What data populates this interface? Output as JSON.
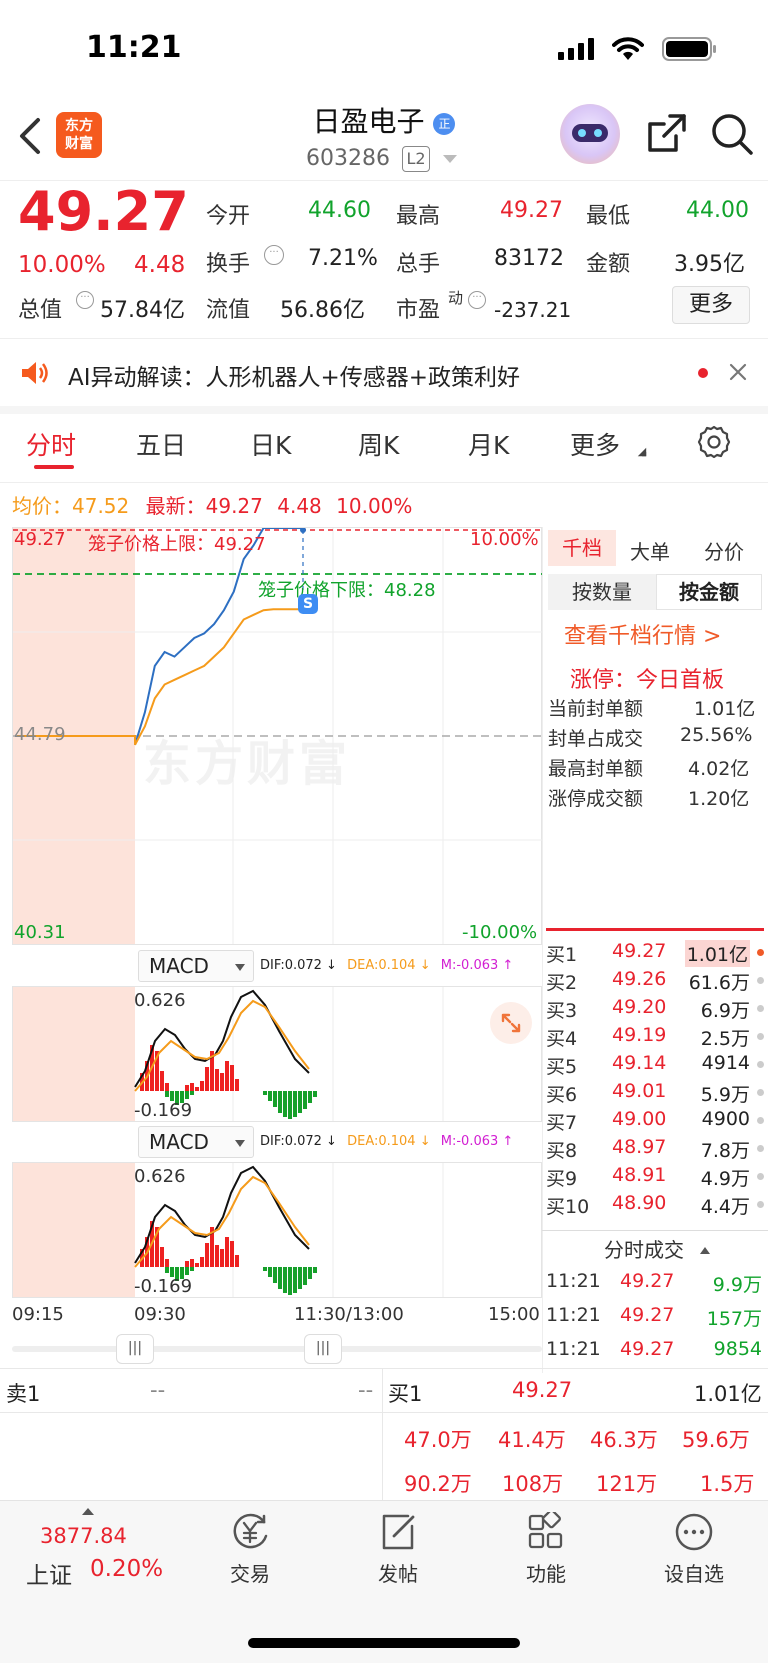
{
  "status_bar": {
    "time": "11:21"
  },
  "header": {
    "stock_name": "日盈电子",
    "code": "603286",
    "level_badge": "L2",
    "logo_text_1": "东方",
    "logo_text_2": "财富"
  },
  "quote": {
    "price": "49.27",
    "change_pct": "10.00%",
    "change": "4.48",
    "open_label": "今开",
    "open": "44.60",
    "high_label": "最高",
    "high": "49.27",
    "low_label": "最低",
    "low": "44.00",
    "turnover_label": "换手",
    "turnover": "7.21%",
    "volume_label": "总手",
    "volume": "83172",
    "amount_label": "金额",
    "amount": "3.95亿",
    "mktcap_label": "总值",
    "mktcap": "57.84亿",
    "float_label": "流值",
    "float": "56.86亿",
    "pe_label": "市盈",
    "pe_sup": "动",
    "pe": "-237.21",
    "more_button": "更多"
  },
  "ai_banner": {
    "text": "AI异动解读：人形机器人+传感器+政策利好"
  },
  "chart_tabs": [
    "分时",
    "五日",
    "日K",
    "周K",
    "月K",
    "更多"
  ],
  "chart_legend": {
    "avg_label": "均价：",
    "avg": "47.52",
    "latest_label": "最新：",
    "latest": "49.27",
    "latest_chg": "4.48",
    "latest_pct": "10.00%"
  },
  "chart_labels": {
    "top_price": "49.27",
    "top_pct": "10.00%",
    "upper_limit_label": "笼子价格上限：49.27",
    "lower_limit_label": "笼子价格下限：48.28",
    "mid_price": "44.79",
    "bottom_price": "40.31",
    "bottom_pct": "-10.00%",
    "watermark": "东方财富",
    "s_marker": "S"
  },
  "chart_data": {
    "type": "line",
    "title": "",
    "ylim": [
      40.31,
      49.27
    ],
    "prev_close": 44.79,
    "x_ticks": [
      "09:15",
      "09:30",
      "11:30/13:00",
      "15:00"
    ],
    "series": [
      {
        "name": "最新",
        "color": "#2d6fc2",
        "values": [
          44.79,
          44.79,
          44.79,
          44.79,
          44.79,
          44.79,
          44.79,
          44.6,
          45.3,
          46.3,
          46.6,
          46.5,
          46.7,
          46.9,
          47.0,
          47.2,
          47.5,
          47.9,
          48.6,
          48.9,
          49.27,
          49.27,
          49.27,
          49.27,
          49.27
        ]
      },
      {
        "name": "均价",
        "color": "#f59b1b",
        "values": [
          44.79,
          44.79,
          44.79,
          44.79,
          44.79,
          44.79,
          44.79,
          44.6,
          45.0,
          45.6,
          45.9,
          46.0,
          46.1,
          46.2,
          46.3,
          46.5,
          46.7,
          47.0,
          47.3,
          47.4,
          47.5,
          47.52,
          47.52,
          47.52,
          47.52
        ]
      }
    ]
  },
  "right_panel": {
    "tabs": [
      "千档",
      "单",
      "分价"
    ],
    "tab_big_order": "大单",
    "subtabs": [
      "按数量",
      "按金额"
    ],
    "link": "查看千档行情 >",
    "limit_up_title": "涨停：今日首板",
    "rows": [
      {
        "label": "当前封单额",
        "value": "1.01亿"
      },
      {
        "label": "封单占成交",
        "value": "25.56%"
      },
      {
        "label": "最高封单额",
        "value": "4.02亿"
      },
      {
        "label": "涨停成交额",
        "value": "1.20亿"
      }
    ],
    "bids": [
      {
        "label": "买1",
        "price": "49.27",
        "vol": "1.01亿"
      },
      {
        "label": "买2",
        "price": "49.26",
        "vol": "61.6万"
      },
      {
        "label": "买3",
        "price": "49.20",
        "vol": "6.9万"
      },
      {
        "label": "买4",
        "price": "49.19",
        "vol": "2.5万"
      },
      {
        "label": "买5",
        "price": "49.14",
        "vol": "4914"
      },
      {
        "label": "买6",
        "price": "49.01",
        "vol": "5.9万"
      },
      {
        "label": "买7",
        "price": "49.00",
        "vol": "4900"
      },
      {
        "label": "买8",
        "price": "48.97",
        "vol": "7.8万"
      },
      {
        "label": "买9",
        "price": "48.91",
        "vol": "4.9万"
      },
      {
        "label": "买10",
        "price": "48.90",
        "vol": "4.4万"
      }
    ],
    "ticks_title": "分时成交",
    "ticks": [
      {
        "time": "11:21",
        "price": "49.27",
        "vol": "9.9万"
      },
      {
        "time": "11:21",
        "price": "49.27",
        "vol": "157万"
      },
      {
        "time": "11:21",
        "price": "49.27",
        "vol": "9854"
      }
    ]
  },
  "macd": {
    "label": "MACD",
    "dif": "DIF:0.072",
    "dea": "DEA:0.104",
    "m": "M:-0.063",
    "top": "0.626",
    "bottom": "-0.169"
  },
  "bottom_book": {
    "sell_label": "卖1",
    "sell_price": "--",
    "sell_vol": "--",
    "buy_label": "买1",
    "buy_price": "49.27",
    "buy_vol": "1.01亿",
    "row1": [
      "47.0万",
      "41.4万",
      "46.3万",
      "59.6万"
    ],
    "row2": [
      "90.2万",
      "108万",
      "121万",
      "1.5万"
    ]
  },
  "bottom_nav": {
    "index_value": "3877.84",
    "index_name": "上证",
    "index_pct": "0.20%",
    "items": [
      "交易",
      "发帖",
      "功能",
      "设自选"
    ]
  }
}
